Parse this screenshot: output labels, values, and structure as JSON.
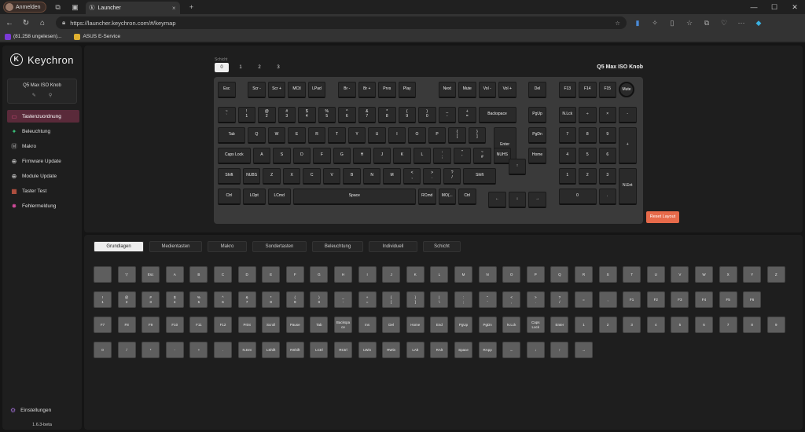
{
  "browser": {
    "profile_label": "Anmelden",
    "tab_title": "Launcher",
    "url": "https://launcher.keychron.com/#/keymap",
    "bookmarks": [
      {
        "label": "(81.258 ungelesen)...",
        "color": "#7a3ad6"
      },
      {
        "label": "ASUS E-Service",
        "color": "#e0b030"
      }
    ]
  },
  "sidebar": {
    "brand": "Keychron",
    "device_name": "Q5 Max ISO Knob",
    "items": [
      {
        "label": "Tastenzuordnung",
        "icon": "keyboard-icon",
        "glyph": "▭",
        "color": "#d04a7a"
      },
      {
        "label": "Beleuchtung",
        "icon": "bulb-icon",
        "glyph": "✦",
        "color": "#3ac07a"
      },
      {
        "label": "Makro",
        "icon": "macro-icon",
        "glyph": "Ⓜ",
        "color": "#aaa"
      },
      {
        "label": "Firmware Update",
        "icon": "plus-circle-icon",
        "glyph": "⊕",
        "color": "#ddd"
      },
      {
        "label": "Module Update",
        "icon": "plus-circle-icon",
        "glyph": "⊕",
        "color": "#ddd"
      },
      {
        "label": "Taster Test",
        "icon": "test-icon",
        "glyph": "▦",
        "color": "#e0604a"
      },
      {
        "label": "Fehlermeldung",
        "icon": "bug-icon",
        "glyph": "✸",
        "color": "#d04a9a"
      }
    ],
    "settings_label": "Einstellungen",
    "version": "1.6.3-beta"
  },
  "keymap": {
    "layer_label": "Schicht",
    "layers": [
      "0",
      "1",
      "2",
      "3"
    ],
    "active_layer": 0,
    "keyboard_title": "Q5 Max ISO Knob",
    "reset_label": "Reset Layout",
    "keys": [
      [
        "Esc",
        "Scr -",
        "Scr +",
        "MCtl",
        "LPad",
        "Br -",
        "Br +",
        "Prvs",
        "Play",
        "Next",
        "Mute",
        "Vol -",
        "Vol +",
        "Del",
        "F13",
        "F14",
        "F15"
      ],
      [
        "~\n`",
        "!\n1",
        "@\n2",
        "#\n3",
        "$\n4",
        "%\n5",
        "^\n6",
        "&\n7",
        "*\n8",
        "(\n9",
        ")\n0",
        "_\n-",
        "+\n=",
        "Backspace",
        "PgUp",
        "N.Lck",
        "÷",
        "×",
        "-"
      ],
      [
        "Tab",
        "Q",
        "W",
        "E",
        "R",
        "T",
        "Y",
        "U",
        "I",
        "O",
        "P",
        "{\n[",
        "}\n]",
        "Enter",
        "PgDn",
        "7",
        "8",
        "9",
        "+"
      ],
      [
        "Caps Lock",
        "A",
        "S",
        "D",
        "F",
        "G",
        "H",
        "J",
        "K",
        "L",
        ":\n;",
        "\"\n'",
        "~\n#",
        "NUHS",
        "Home",
        "4",
        "5",
        "6"
      ],
      [
        "Shift",
        "NUBS",
        "Z",
        "X",
        "C",
        "V",
        "B",
        "N",
        "M",
        "<\n,",
        ">\n.",
        "?\n/",
        "Shift",
        "↑",
        "1",
        "2",
        "3",
        "N.Ent"
      ],
      [
        "Ctrl",
        "LOpt",
        "LCmd",
        "Space",
        "RCmd",
        "MO(...",
        "Ctrl",
        "←",
        "↓",
        "→",
        "0",
        "."
      ]
    ],
    "knob_label": "Mute"
  },
  "palette": {
    "tabs": [
      "Grundlagen",
      "Medientasten",
      "Makro",
      "Sondertasten",
      "Beleuchtung",
      "Individuell",
      "Schicht"
    ],
    "active_tab": 0,
    "rows": [
      [
        "",
        "▽",
        "Esc",
        "A",
        "B",
        "C",
        "D",
        "E",
        "F",
        "G",
        "H",
        "I",
        "J",
        "K",
        "L",
        "M",
        "N",
        "O",
        "P",
        "Q",
        "R",
        "S",
        "T",
        "U",
        "V",
        "W",
        "X",
        "Y",
        "Z"
      ],
      [
        "!\n1",
        "@\n2",
        "#\n3",
        "$\n4",
        "%\n5",
        "^\n6",
        "&\n7",
        "*\n8",
        "(\n9",
        ")\n0",
        "_\n-",
        "+\n=",
        "{\n[",
        "}\n]",
        "|\n\\",
        ":\n;",
        "\"\n'",
        "<\n,",
        ">\n.",
        "?\n/",
        "=",
        ",",
        "F1",
        "F2",
        "F3",
        "F4",
        "F5",
        "F6"
      ],
      [
        "F7",
        "F8",
        "F9",
        "F10",
        "F11",
        "F12",
        "Print",
        "Scroll",
        "Pause",
        "Tab",
        "Backspa\nce",
        "Ins",
        "Del",
        "Home",
        "End",
        "PgUp",
        "PgDn",
        "N.Lck",
        "Caps\nLock",
        "Enter",
        "1",
        "2",
        "3",
        "4",
        "5",
        "6",
        "7",
        "8",
        "9"
      ],
      [
        "0",
        "/",
        "*",
        "-",
        "+",
        ".",
        "N.Ent",
        "LShift",
        "RShift",
        "LCtrl",
        "RCtrl",
        "LWin",
        "RWin",
        "LAlt",
        "RAlt",
        "Space",
        "RApp",
        "←",
        "↓",
        "↑",
        "→"
      ]
    ]
  }
}
